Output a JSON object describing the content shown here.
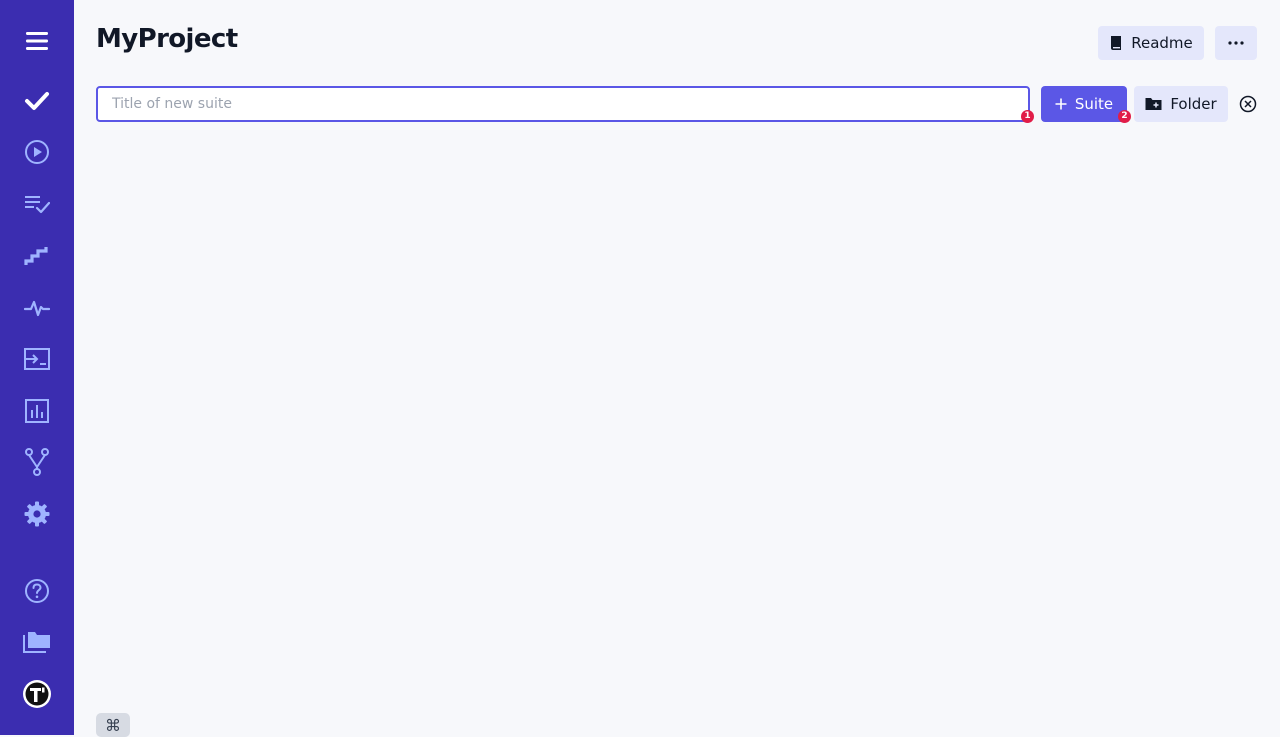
{
  "project": {
    "title": "MyProject"
  },
  "header": {
    "readme_label": "Readme"
  },
  "suite_form": {
    "placeholder": "Title of new suite",
    "value": "",
    "input_hint_badge": "1",
    "suite_button_label": "Suite",
    "suite_hint_badge": "2",
    "folder_button_label": "Folder"
  },
  "shortcut": {
    "symbol": "⌘"
  },
  "sidebar": {
    "items": [
      {
        "icon": "menu-icon"
      },
      {
        "icon": "check-icon",
        "active": true
      },
      {
        "icon": "play-circle-icon"
      },
      {
        "icon": "list-check-icon"
      },
      {
        "icon": "stairs-icon"
      },
      {
        "icon": "pulse-icon"
      },
      {
        "icon": "import-icon"
      },
      {
        "icon": "bar-chart-icon"
      },
      {
        "icon": "branch-icon"
      },
      {
        "icon": "gear-icon"
      },
      {
        "icon": "help-icon"
      },
      {
        "icon": "projects-folder-icon"
      },
      {
        "icon": "avatar-logo-icon"
      }
    ]
  },
  "colors": {
    "sidebar_bg": "#3b2db0",
    "sidebar_icon": "#9fb4ff",
    "accent": "#5b57e6",
    "badge": "#e11d48",
    "light_button": "#e4e7fb",
    "page_bg": "#f7f8fb"
  }
}
